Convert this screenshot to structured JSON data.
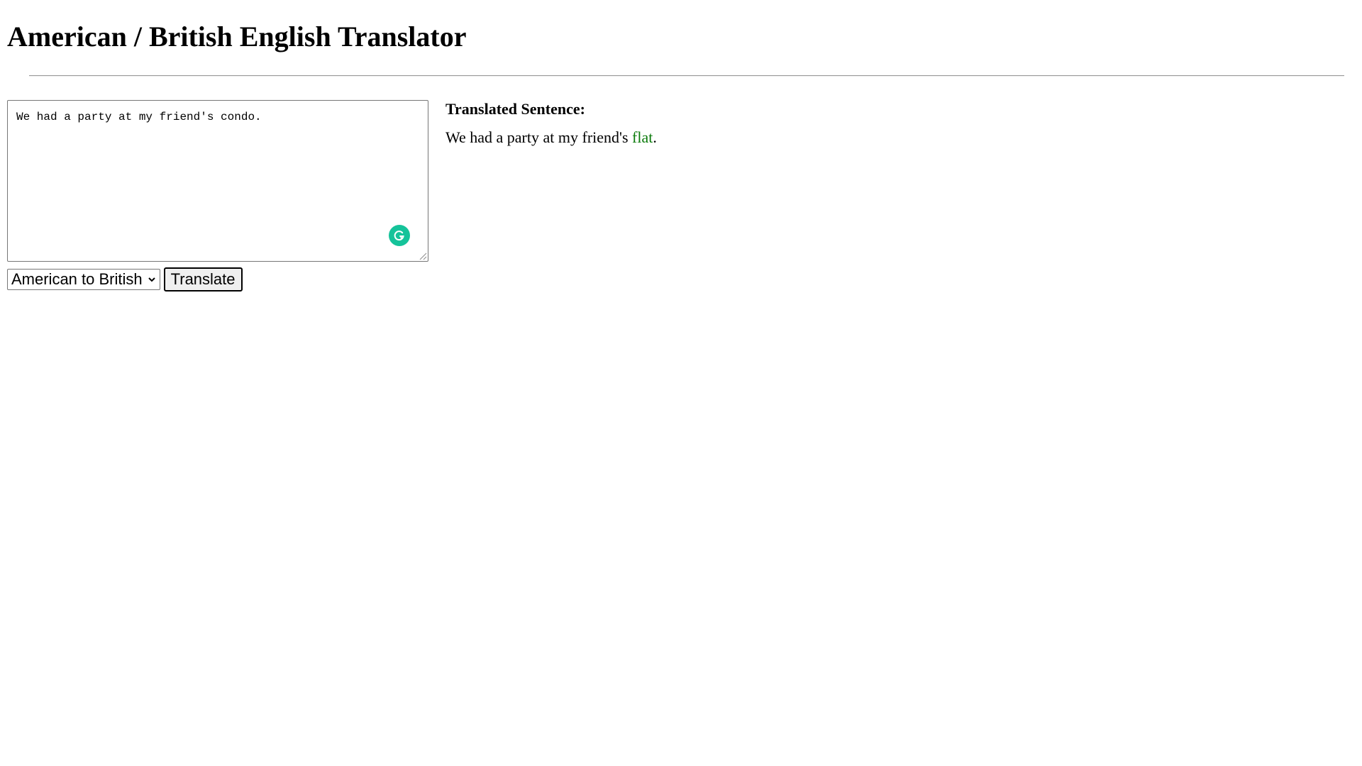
{
  "header": {
    "title": "American / British English Translator"
  },
  "input": {
    "value": "We had a party at my friend's condo."
  },
  "controls": {
    "locale_selected": "American to British",
    "translate_label": "Translate"
  },
  "output": {
    "heading": "Translated Sentence:",
    "sentence_before": "We had a party at my friend's ",
    "translated_word": "flat",
    "sentence_after": "."
  },
  "colors": {
    "highlight": "#0a7a0a",
    "grammarly": "#15c39a"
  },
  "icons": {
    "grammarly": "grammarly-icon",
    "select_arrow": "chevron-down-icon"
  }
}
